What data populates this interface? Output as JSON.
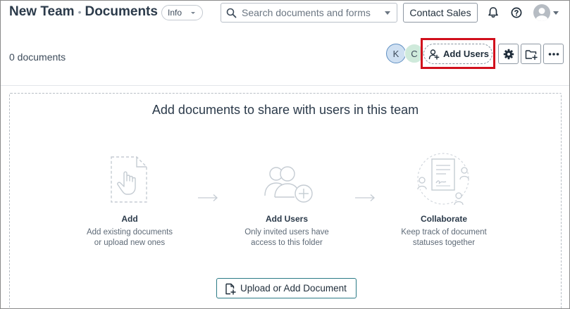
{
  "header": {
    "team_name": "New Team",
    "separator": "•",
    "section": "Documents",
    "info_label": "Info",
    "search_placeholder": "Search documents and forms",
    "contact_sales_label": "Contact Sales",
    "icons": [
      "bell-icon",
      "help-icon",
      "user-avatar-icon"
    ]
  },
  "toolbar": {
    "doc_count": "0 documents",
    "members": [
      "K",
      "C"
    ],
    "add_users_label": "Add Users",
    "icons": [
      "gear-icon",
      "new-folder-icon",
      "more-icon"
    ]
  },
  "empty_state": {
    "title": "Add documents to share with users in this team",
    "steps": [
      {
        "title": "Add",
        "line1": "Add existing documents",
        "line2": "or upload new ones"
      },
      {
        "title": "Add Users",
        "line1": "Only invited users have",
        "line2": "access to this folder"
      },
      {
        "title": "Collaborate",
        "line1": "Keep track of document",
        "line2": "statuses together"
      }
    ],
    "upload_label": "Upload or Add Document"
  },
  "colors": {
    "highlight": "#d10f1c",
    "upload_border": "#2b7a86",
    "avatar_k_bg": "#cfe0f2",
    "avatar_c_bg": "#cfeadb"
  }
}
